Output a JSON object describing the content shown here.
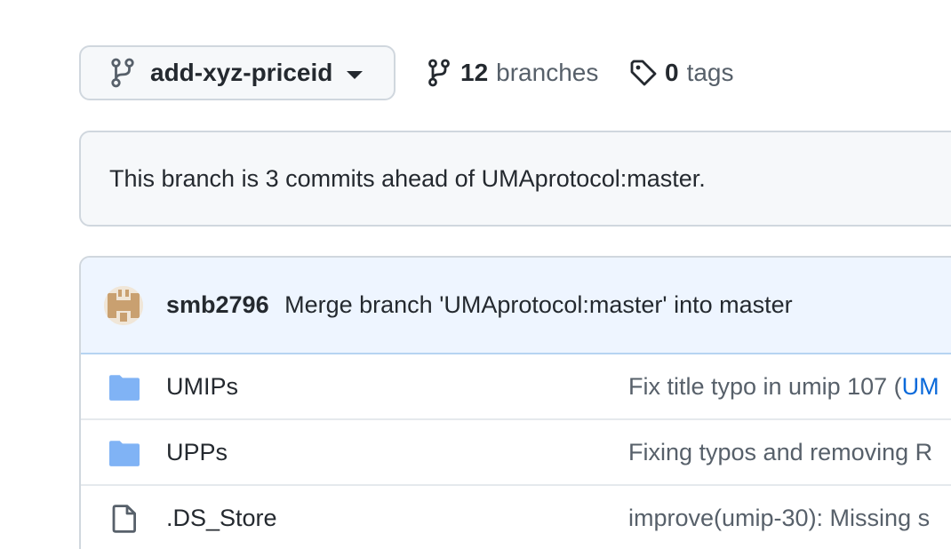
{
  "branch_selector": {
    "name": "add-xyz-priceid"
  },
  "branches": {
    "count": "12",
    "label": "branches"
  },
  "tags": {
    "count": "0",
    "label": "tags"
  },
  "ahead_notice": "This branch is 3 commits ahead of UMAprotocol:master.",
  "latest_commit": {
    "author": "smb2796",
    "message": "Merge branch 'UMAprotocol:master' into master"
  },
  "files": [
    {
      "type": "folder",
      "name": "UMIPs",
      "commit_message": "Fix title typo in umip 107 (",
      "commit_ref": "UM"
    },
    {
      "type": "folder",
      "name": "UPPs",
      "commit_message": "Fixing typos and removing R",
      "commit_ref": ""
    },
    {
      "type": "file",
      "name": ".DS_Store",
      "commit_message": "improve(umip-30): Missing s",
      "commit_ref": ""
    }
  ],
  "colors": {
    "folder": "#80b3f5",
    "link": "#0969da",
    "commit_bar": "#eef5ff",
    "avatar": "#c9a070"
  }
}
